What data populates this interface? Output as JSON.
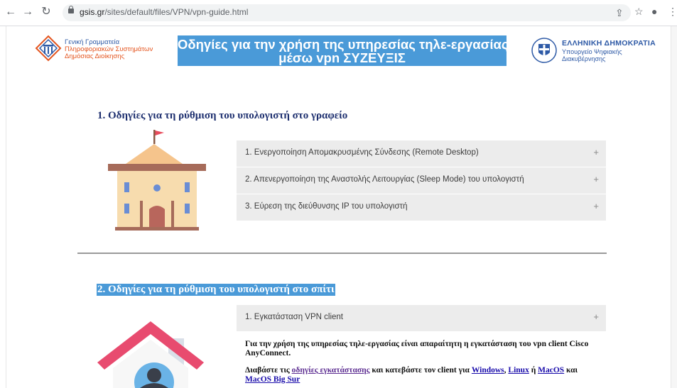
{
  "browser": {
    "url_domain": "gsis.gr",
    "url_path": "/sites/default/files/VPN/vpn-guide.html"
  },
  "header": {
    "left_logo": {
      "line1": "Γενική Γραμματεία",
      "line2": "Πληροφοριακών Συστημάτων",
      "line3": "Δημόσιας Διοίκησης"
    },
    "banner": {
      "line1": "Οδηγίες για την χρήση της υπηρεσίας τηλε-εργασίας",
      "line2": "μέσω vpn ΣΥΖΕΥΞΙΣ"
    },
    "right_logo": {
      "line1": "ΕΛΛΗΝΙΚΗ ΔΗΜΟΚΡΑΤΙΑ",
      "line2": "Υπουργείο Ψηφιακής",
      "line3": "Διακυβέρνησης"
    }
  },
  "section1": {
    "title": "1. Οδηγίες για τη ρύθμιση του υπολογιστή στο γραφείο",
    "items": [
      {
        "label": "1. Ενεργοποίηση Απομακρυσμένης Σύνδεσης (Remote Desktop)",
        "icon": "+"
      },
      {
        "label": "2. Απενεργοποίηση της Αναστολής Λειτουργίας (Sleep Mode) του υπολογιστή",
        "icon": "+"
      },
      {
        "label": "3. Εύρεση της διεύθυνσης IP του υπολογιστή",
        "icon": "+"
      }
    ]
  },
  "section2": {
    "title": "2. Οδηγίες για τη ρύθμιση του υπολογιστή στο σπίτι",
    "items": [
      {
        "label": "1. Εγκατάσταση VPN client",
        "icon": "+"
      }
    ],
    "para1": "Για την χρήση της υπηρεσίας τηλε-εργασίας είναι απαραίτητη η εγκατάσταση του vpn client Cisco AnyConnect.",
    "para2_prefix": "Διαβάστε τις ",
    "para2_link": "οδηγίες εγκατάστασης",
    "para2_mid": " και κατεβάστε τον client για ",
    "link_windows": "Windows",
    "sep1": ", ",
    "link_linux": "Linux",
    "sep2": " ή ",
    "link_macos": "MacOS",
    "sep3": " και",
    "link_macos_bigsur": "MacOS Big Sur"
  },
  "colors": {
    "banner_bg": "#4a9ad8",
    "title_blue": "#1d2f6f",
    "accordion_bg": "#ececec",
    "logo_orange": "#e4551f"
  }
}
